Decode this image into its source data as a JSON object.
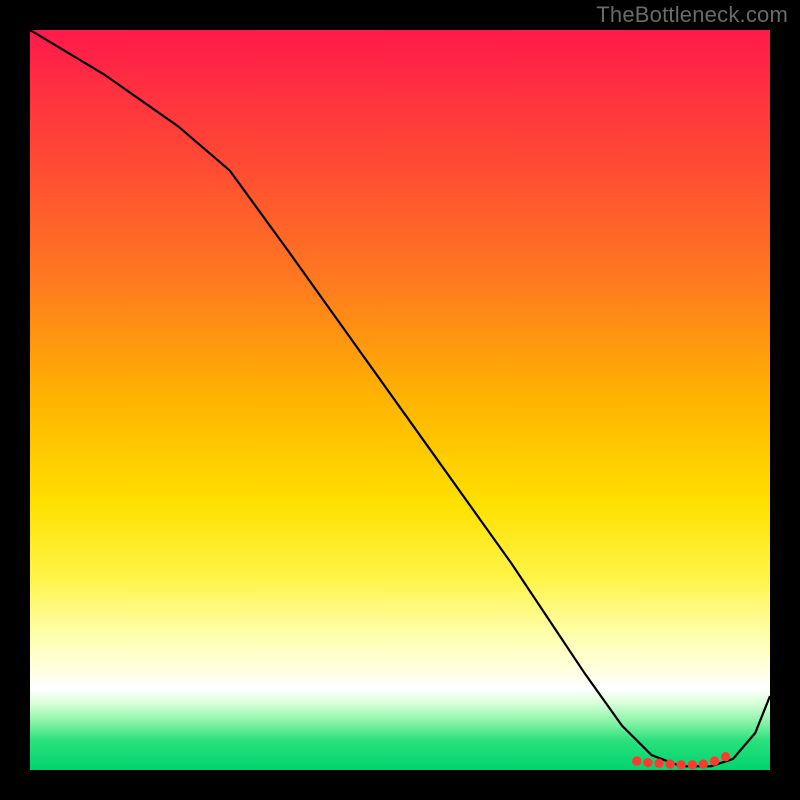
{
  "watermark": "TheBottleneck.com",
  "colors": {
    "background": "#000000",
    "curve": "#000000",
    "dot": "#ff3b30"
  },
  "chart_data": {
    "type": "line",
    "title": "",
    "xlabel": "",
    "ylabel": "",
    "xlim": [
      0,
      100
    ],
    "ylim": [
      0,
      100
    ],
    "grid": false,
    "series": [
      {
        "name": "bottleneck-curve",
        "x": [
          0,
          10,
          20,
          27,
          35,
          45,
          55,
          65,
          75,
          80,
          84,
          88,
          92,
          95,
          98,
          100
        ],
        "values": [
          100,
          94,
          87,
          81,
          70,
          56,
          42,
          28,
          13,
          6,
          2,
          0.5,
          0.5,
          1.5,
          5,
          10
        ]
      }
    ],
    "markers": [
      {
        "name": "bottom-cluster-1",
        "x": 82,
        "y": 1.2
      },
      {
        "name": "bottom-cluster-2",
        "x": 83.5,
        "y": 1.0
      },
      {
        "name": "bottom-cluster-3",
        "x": 85,
        "y": 0.9
      },
      {
        "name": "bottom-cluster-4",
        "x": 86.5,
        "y": 0.8
      },
      {
        "name": "bottom-cluster-5",
        "x": 88,
        "y": 0.7
      },
      {
        "name": "bottom-cluster-6",
        "x": 89.5,
        "y": 0.7
      },
      {
        "name": "bottom-cluster-7",
        "x": 91,
        "y": 0.8
      },
      {
        "name": "bottom-cluster-8",
        "x": 92.5,
        "y": 1.2
      },
      {
        "name": "bottom-cluster-9",
        "x": 94,
        "y": 1.8
      }
    ]
  }
}
